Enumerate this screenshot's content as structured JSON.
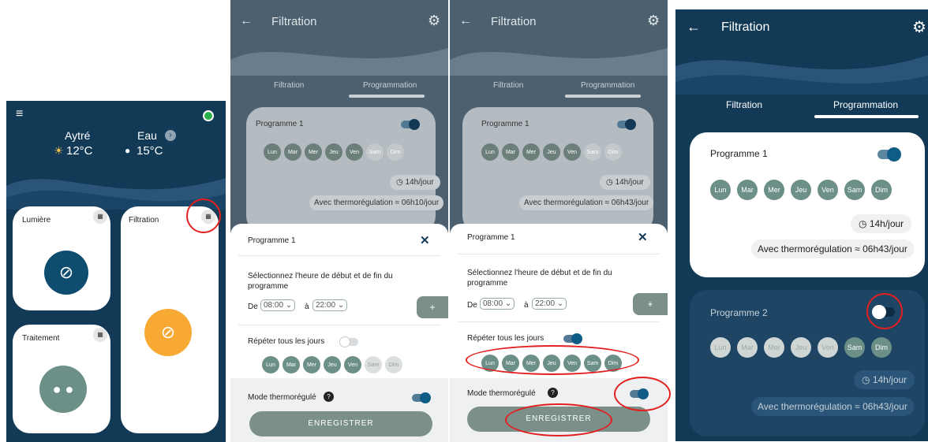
{
  "panel1": {
    "location": "Aytré",
    "air_temp": "12°C",
    "water_label": "Eau",
    "water_temp": "15°C",
    "cards": {
      "lumiere": "Lumière",
      "filtration": "Filtration",
      "traitement": "Traitement"
    }
  },
  "panel2": {
    "header_title": "Filtration",
    "tabs": [
      "Filtration",
      "Programmation"
    ],
    "program_title": "Programme 1",
    "days": [
      "Lun",
      "Mar",
      "Mer",
      "Jeu",
      "Ven",
      "Sam",
      "Dim"
    ],
    "duration": "14h/jour",
    "thermo": "Avec thermorégulation ≈ 06h10/jour",
    "sheet": {
      "title": "Programme 1",
      "close": "✕",
      "select_text": "Sélectionnez l'heure de début et de fin du programme",
      "de_label": "De",
      "start": "08:00",
      "a_label": "à",
      "end": "22:00",
      "add": "+",
      "repeat_label": "Répéter tous les jours",
      "mode_label": "Mode thermorégulé",
      "help": "?",
      "save": "ENREGISTRER"
    }
  },
  "panel3": {
    "header_title": "Filtration",
    "tabs": [
      "Filtration",
      "Programmation"
    ],
    "program_title": "Programme 1",
    "days": [
      "Lun",
      "Mar",
      "Mer",
      "Jeu",
      "Ven",
      "Sam",
      "Dim"
    ],
    "duration": "14h/jour",
    "thermo": "Avec thermorégulation ≈ 06h43/jour",
    "sheet": {
      "title": "Programme 1",
      "close": "✕",
      "select_text": "Sélectionnez l'heure de début et de fin du programme",
      "de_label": "De",
      "start": "08:00",
      "a_label": "à",
      "end": "22:00",
      "add": "+",
      "repeat_label": "Répéter tous les jours",
      "mode_label": "Mode thermorégulé",
      "help": "?",
      "save": "ENREGISTRER"
    }
  },
  "panel4": {
    "header_title": "Filtration",
    "tabs": [
      "Filtration",
      "Programmation"
    ],
    "program1_title": "Programme 1",
    "program2_title": "Programme 2",
    "days": [
      "Lun",
      "Mar",
      "Mer",
      "Jeu",
      "Ven",
      "Sam",
      "Dim"
    ],
    "duration1": "14h/jour",
    "thermo1": "Avec thermorégulation ≈ 06h43/jour",
    "duration2": "14h/jour",
    "thermo2": "Avec thermorégulation ≈ 06h43/jour"
  },
  "colors": {
    "navy": "#123a57",
    "mid_blue": "#2a5578",
    "day_green": "#6c8f88",
    "day_light": "#d0d6d4",
    "switch_blue": "#0f5d87",
    "orange": "#f7a934",
    "highlight_red": "#e32020",
    "status_green": "#2bb04a"
  }
}
